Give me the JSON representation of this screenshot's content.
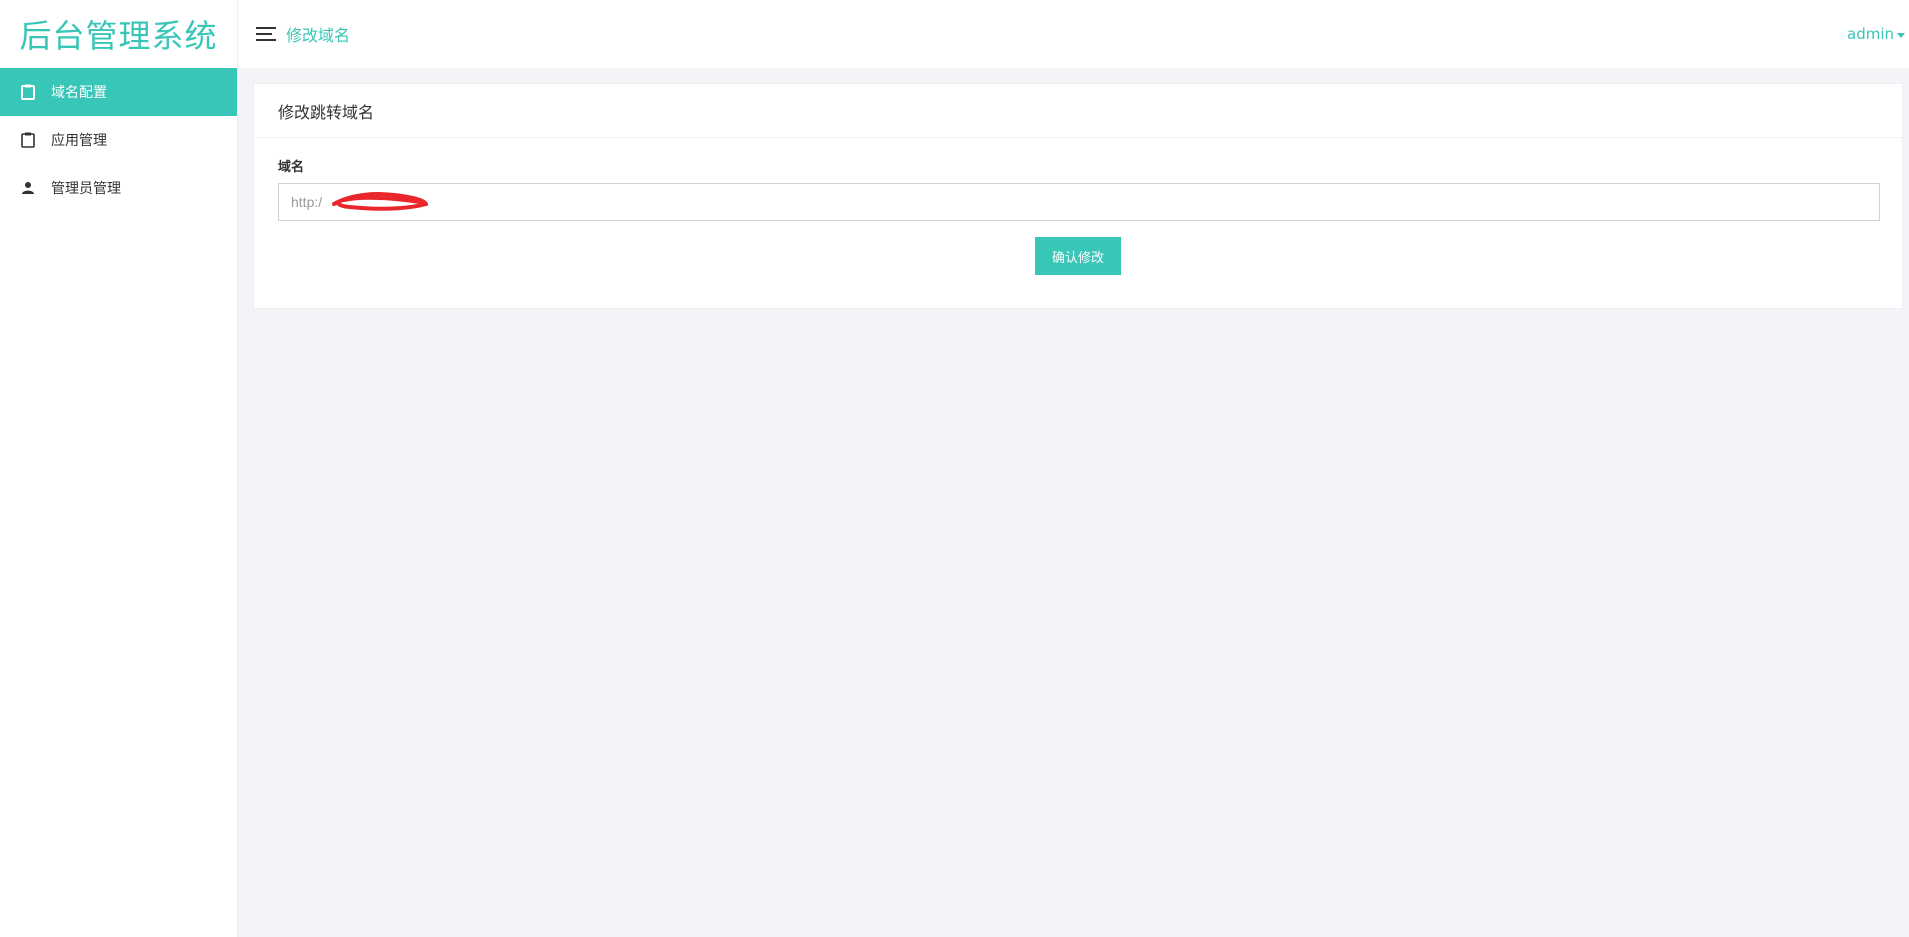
{
  "brand": {
    "title": "后台管理系统"
  },
  "sidebar": {
    "items": [
      {
        "label": "域名配置",
        "icon": "clipboard-icon",
        "active": true
      },
      {
        "label": "应用管理",
        "icon": "clipboard-icon",
        "active": false
      },
      {
        "label": "管理员管理",
        "icon": "person-icon",
        "active": false
      }
    ]
  },
  "topbar": {
    "title": "修改域名",
    "user": "admin",
    "menu_icon": "hamburger-icon"
  },
  "card": {
    "title": "修改跳转域名",
    "field_label": "域名",
    "field_value": "http:/",
    "submit_label": "确认修改"
  },
  "colors": {
    "accent": "#37c6b7",
    "background": "#f3f4f8",
    "redaction": "#e8262b"
  }
}
